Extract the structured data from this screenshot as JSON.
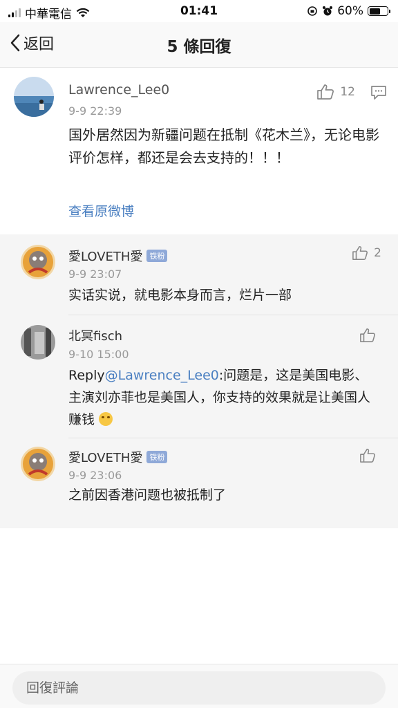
{
  "status_bar": {
    "carrier": "中華電信",
    "time": "01:41",
    "battery": "60%",
    "battery_level": 0.6
  },
  "nav": {
    "back_label": "返回",
    "title": "5 條回復"
  },
  "post": {
    "username": "Lawrence_Lee0",
    "timestamp": "9-9 22:39",
    "text": "国外居然因为新疆问题在抵制《花木兰》，无论电影评价怎样，都还是会去支持的！！！",
    "likes": "12",
    "view_original": "查看原微博"
  },
  "replies": [
    {
      "username": "愛LOVETH愛",
      "badge": "铁粉",
      "timestamp": "9-9 23:07",
      "text": "实话实说，就电影本身而言，烂片一部",
      "likes": "2"
    },
    {
      "username": "北冥fisch",
      "timestamp": "9-10 15:00",
      "reply_prefix": "Reply",
      "mention": "@Lawrence_Lee0",
      "text": ":问题是，这是美国电影、主演刘亦菲也是美国人，你支持的效果就是让美国人赚钱",
      "likes": ""
    },
    {
      "username": "愛LOVETH愛",
      "badge": "铁粉",
      "timestamp": "9-9 23:06",
      "text": "之前因香港问题也被抵制了",
      "likes": ""
    }
  ],
  "bottom": {
    "input_placeholder": "回復評論"
  },
  "colors": {
    "link": "#4a7fc1",
    "badge": "#8fa9d8",
    "reply_bg": "#f5f5f5"
  }
}
